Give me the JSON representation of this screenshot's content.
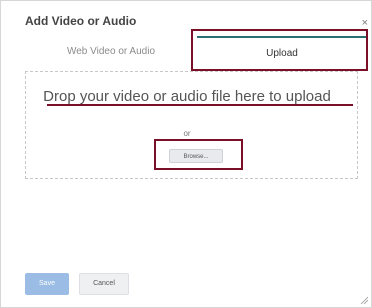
{
  "dialog": {
    "title": "Add Video or Audio",
    "close_symbol": "×"
  },
  "tabs": [
    {
      "label": "Web Video or Audio",
      "active": false
    },
    {
      "label": "Upload",
      "active": true
    }
  ],
  "dropzone": {
    "prompt": "Drop your video or audio file here to upload",
    "or_text": "or",
    "browse_label": "Browse..."
  },
  "footer": {
    "save_label": "Save",
    "cancel_label": "Cancel"
  },
  "icons": {
    "close": "close-icon",
    "resize": "resize-grip-icon"
  },
  "colors": {
    "highlight": "#7a1028",
    "active_tab": "#2b6f73",
    "primary_button": "#9bbde5"
  }
}
